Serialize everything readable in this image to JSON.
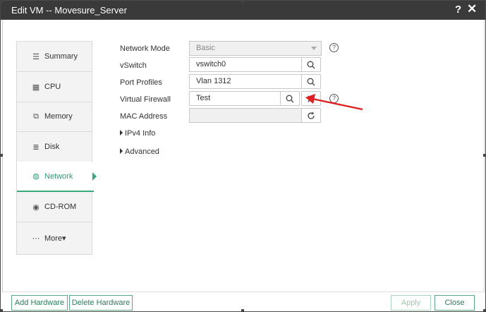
{
  "window": {
    "title": "Edit VM -- Movesure_Server",
    "help_label": "?",
    "close_label": "✕"
  },
  "nav": {
    "items": [
      {
        "label": "Summary",
        "icon": "list-icon"
      },
      {
        "label": "CPU",
        "icon": "cpu-icon"
      },
      {
        "label": "Memory",
        "icon": "memory-icon"
      },
      {
        "label": "Disk",
        "icon": "disk-icon"
      },
      {
        "label": "Network",
        "icon": "globe-icon",
        "active": true
      },
      {
        "label": "CD-ROM",
        "icon": "cdrom-icon"
      },
      {
        "label": "More▾",
        "icon": "more-icon"
      }
    ]
  },
  "form": {
    "network_mode": {
      "label": "Network Mode",
      "value": "Basic"
    },
    "vswitch": {
      "label": "vSwitch",
      "value": "vswitch0"
    },
    "port_profiles": {
      "label": "Port Profiles",
      "value": "Vlan 1312"
    },
    "virtual_firewall": {
      "label": "Virtual Firewall",
      "value": "Test"
    },
    "mac_address": {
      "label": "MAC Address",
      "value": ""
    },
    "ipv4_info": {
      "label": "IPv4 Info"
    },
    "advanced": {
      "label": "Advanced"
    }
  },
  "footer": {
    "add_hardware": "Add Hardware",
    "delete_hardware": "Delete Hardware",
    "apply": "Apply",
    "close": "Close"
  },
  "colors": {
    "accent": "#3aa87a",
    "titlebar": "#3a3a3a",
    "annotation_arrow": "#e02020"
  }
}
